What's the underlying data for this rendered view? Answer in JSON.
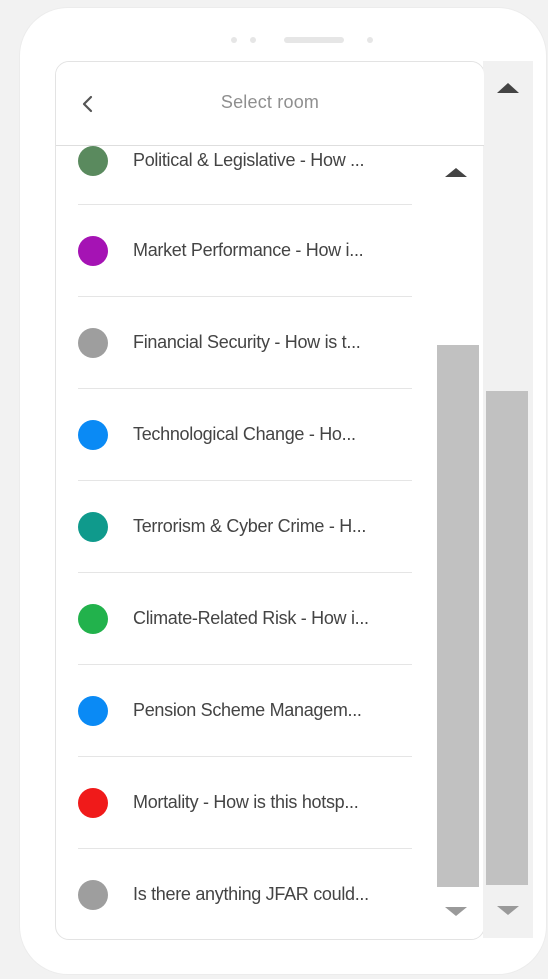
{
  "header": {
    "title": "Select room",
    "back_icon": "chevron-left-icon"
  },
  "rooms": [
    {
      "label": "Political & Legislative - How ...",
      "color": "#5a8a5e"
    },
    {
      "label": "Market Performance - How i...",
      "color": "#a513b4"
    },
    {
      "label": "Financial Security - How is t...",
      "color": "#9e9e9e"
    },
    {
      "label": "Technological Change - Ho...",
      "color": "#0a8af5"
    },
    {
      "label": "Terrorism & Cyber Crime - H...",
      "color": "#0f9a8c"
    },
    {
      "label": "Climate-Related Risk - How i...",
      "color": "#22b24c"
    },
    {
      "label": "Pension Scheme Managem...",
      "color": "#0a8af5"
    },
    {
      "label": "Mortality - How is this hotsp...",
      "color": "#f01a1a"
    },
    {
      "label": "Is there anything JFAR could...",
      "color": "#9e9e9e"
    }
  ],
  "scrollbars": {
    "up_icon": "triangle-up-icon",
    "down_icon": "triangle-down-icon"
  }
}
